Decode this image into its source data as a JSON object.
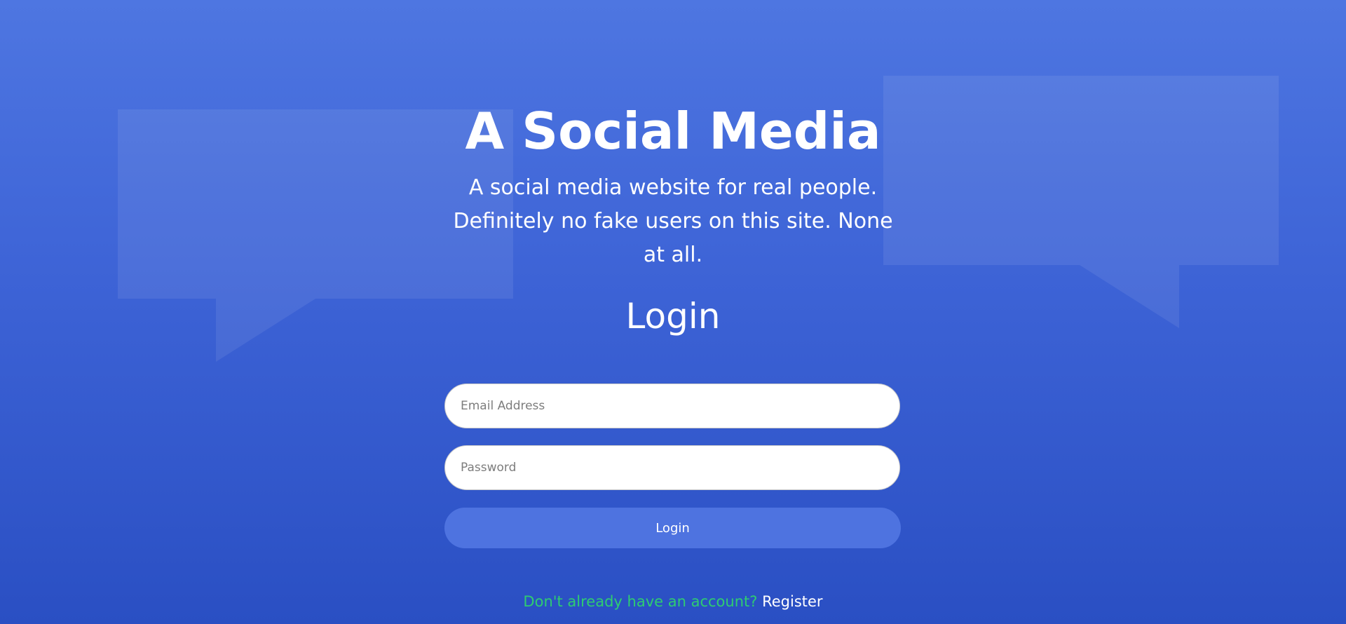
{
  "header": {
    "title": "A Social Media",
    "tagline": "A social media website for real people. Definitely no fake users on this site. None at all."
  },
  "login": {
    "heading": "Login",
    "email_placeholder": "Email Address",
    "password_placeholder": "Password",
    "button_label": "Login"
  },
  "footer": {
    "register_prompt": "Don't already have an account?",
    "register_link": "Register"
  },
  "colors": {
    "background_top": "#4e76e1",
    "background_bottom": "#2a4fc3",
    "button": "#4e73e0",
    "prompt_text": "#2ecc71",
    "text": "#ffffff"
  },
  "icons": [
    "speech-bubble-left-icon",
    "speech-bubble-right-icon"
  ]
}
